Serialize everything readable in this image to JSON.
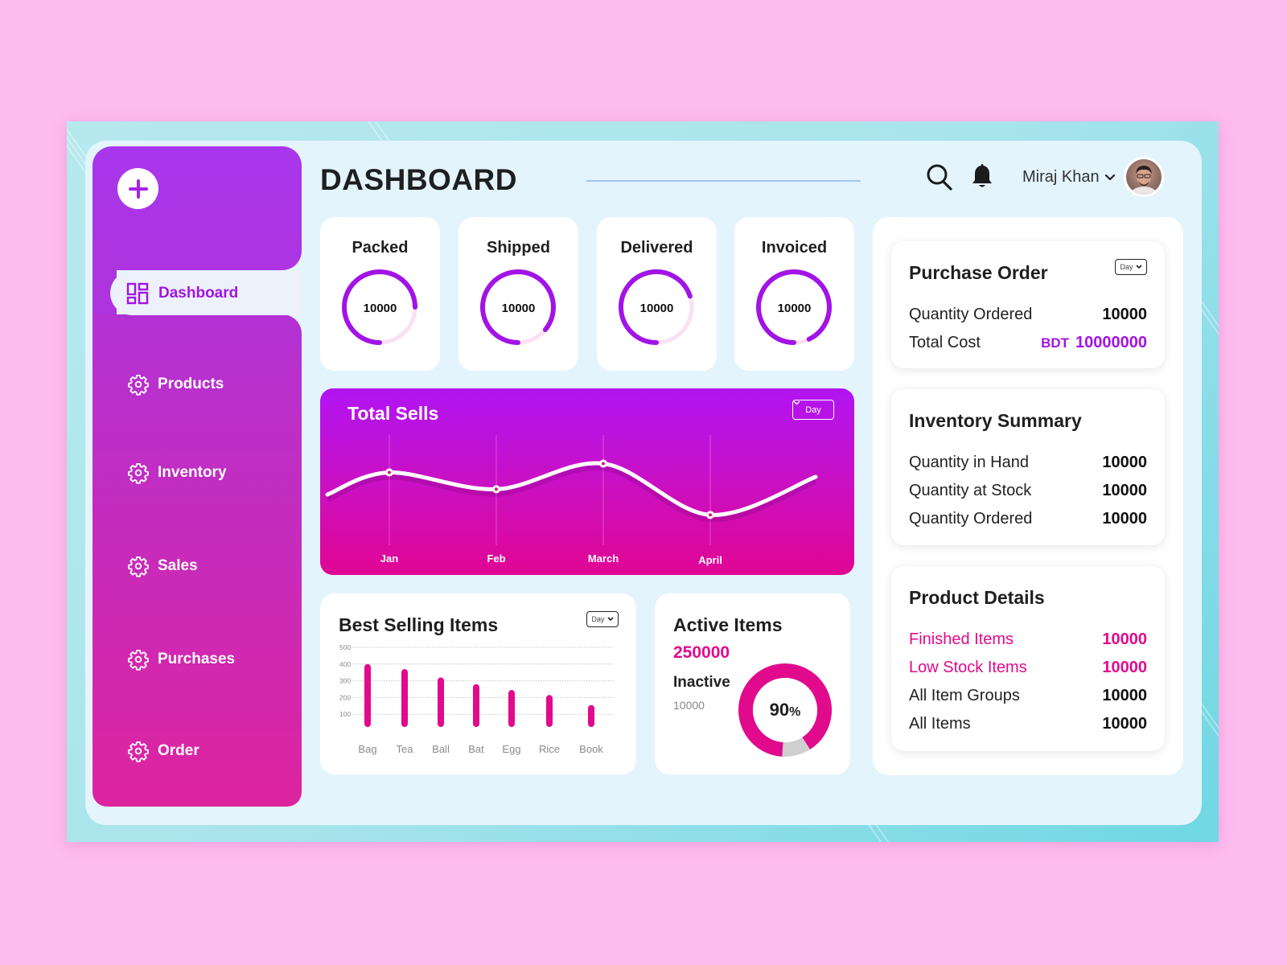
{
  "colors": {
    "page_bg": "#fdbcee",
    "primary_purple": "#a213e6",
    "accent_pink": "#e10a8d",
    "ring_track": "#fbe0f3",
    "donut_rest": "#cfcfcf"
  },
  "sidebar": {
    "add_icon": "plus-icon",
    "items": [
      {
        "label": "Dashboard",
        "icon": "dashboard-grid-icon",
        "active": true
      },
      {
        "label": "Products",
        "icon": "gear-icon",
        "active": false
      },
      {
        "label": "Inventory",
        "icon": "gear-icon",
        "active": false
      },
      {
        "label": "Sales",
        "icon": "gear-icon",
        "active": false
      },
      {
        "label": "Purchases",
        "icon": "gear-icon",
        "active": false
      },
      {
        "label": "Order",
        "icon": "gear-icon",
        "active": false
      }
    ]
  },
  "header": {
    "title": "DASHBOARD",
    "search_icon": "search-icon",
    "notification_icon": "bell-icon",
    "user_name": "Miraj Khan",
    "user_menu_icon": "chevron-down-icon"
  },
  "stats": [
    {
      "label": "Packed",
      "value": "10000",
      "progress": 0.75
    },
    {
      "label": "Shipped",
      "value": "10000",
      "progress": 0.86
    },
    {
      "label": "Delivered",
      "value": "10000",
      "progress": 0.7
    },
    {
      "label": "Invoiced",
      "value": "10000",
      "progress": 0.93
    }
  ],
  "total_sells": {
    "title": "Total Sells",
    "period": "Day"
  },
  "best_selling": {
    "title": "Best  Selling Items",
    "period": "Day"
  },
  "active_items": {
    "title": "Active Items",
    "active_value": "250000",
    "inactive_label": "Inactive",
    "inactive_value": "10000",
    "percent_label": "90",
    "percent_sign": "%",
    "percent": 90
  },
  "purchase_order": {
    "title": "Purchase Order",
    "period": "Day",
    "rows": [
      {
        "label": "Quantity Ordered",
        "value": "10000"
      },
      {
        "label": "Total Cost",
        "currency": "BDT",
        "value": "10000000"
      }
    ]
  },
  "inventory_summary": {
    "title": "Inventory Summary",
    "rows": [
      {
        "label": "Quantity in Hand",
        "value": "10000"
      },
      {
        "label": "Quantity at Stock",
        "value": "10000"
      },
      {
        "label": "Quantity Ordered",
        "value": "10000"
      }
    ]
  },
  "product_details": {
    "title": "Product Details",
    "rows": [
      {
        "label": "Finished Items",
        "value": "10000",
        "highlight": true
      },
      {
        "label": "Low Stock Items",
        "value": "10000",
        "highlight": true
      },
      {
        "label": "All Item Groups",
        "value": "10000",
        "highlight": false
      },
      {
        "label": "All Items",
        "value": "10000",
        "highlight": false
      }
    ]
  },
  "chart_data": [
    {
      "type": "line",
      "title": "Total Sells",
      "xlabel": "",
      "ylabel": "",
      "categories": [
        "Jan",
        "Feb",
        "March",
        "April"
      ],
      "series": [
        {
          "name": "Total Sells",
          "values": [
            55,
            36,
            65,
            7
          ]
        }
      ],
      "curve_start": 30,
      "curve_end": 50,
      "ylim": [
        0,
        100
      ],
      "smooth": true,
      "grid": false
    },
    {
      "type": "bar",
      "title": "Best  Selling Items",
      "categories": [
        "Bag",
        "Tea",
        "Ball",
        "Bat",
        "Egg",
        "Rice",
        "Book"
      ],
      "values": [
        400,
        370,
        320,
        280,
        245,
        215,
        155
      ],
      "yticks": [
        100,
        200,
        300,
        400,
        500
      ],
      "ylim": [
        0,
        500
      ],
      "grid": true
    },
    {
      "type": "pie",
      "title": "Active Items",
      "categories": [
        "Active",
        "Inactive"
      ],
      "values": [
        90,
        10
      ],
      "center_label": "90%"
    }
  ]
}
